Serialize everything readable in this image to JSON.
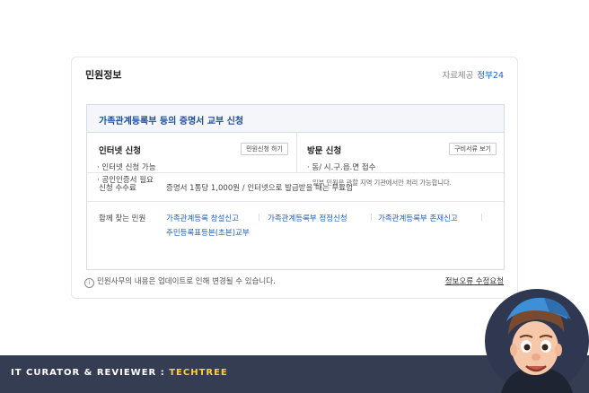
{
  "card": {
    "title": "민원정보",
    "source_label": "자료제공",
    "source_brand": "정부24"
  },
  "service": {
    "title": "가족관계등록부 등의 증명서 교부 신청",
    "online": {
      "title": "인터넷 신청",
      "button": "민원신청 하기",
      "lines": [
        "· 인터넷 신청 가능",
        "· 공인인증서 필요"
      ]
    },
    "visit": {
      "title": "방문 신청",
      "button": "구비서류 보기",
      "lines": [
        "· 동/ 시.구.읍.면 접수"
      ],
      "note": "일부 민원은 관할 지역 기관에서만 처리 가능합니다."
    },
    "fee": {
      "label": "신청 수수료",
      "value": "증명서 1통당 1,000원 / 인터넷으로 발급받을 때는 무료임"
    },
    "related": {
      "label": "함께 찾는 민원",
      "links": [
        "가족관계등록 창설신고",
        "가족관계등록부 정정신청",
        "가족관계등록부 존재신고",
        "주민등록표등본(초본)교부"
      ]
    }
  },
  "footer": {
    "info_icon": "i",
    "note": "민원사무의 내용은 업데이트로 인해 변경될 수 있습니다.",
    "report_link": "정보오류 수정요청"
  },
  "banner": {
    "prefix": "IT CURATOR & REVIEWER : ",
    "brand": "TECHTREE"
  },
  "colors": {
    "link": "#1f5fbf",
    "banner_bg": "#353d53",
    "banner_brand": "#f5d23c"
  },
  "avatar_icon": "cartoon-avatar-icon"
}
